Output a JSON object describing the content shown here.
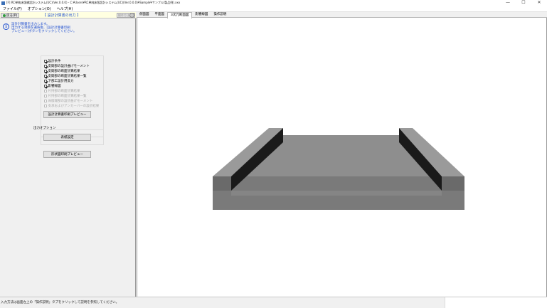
{
  "window": {
    "title": "[F] RC単純床版橋設計システム(UC)(Ver.0.0.0) - C:¥Users¥RC単純床版設計システム(UC)(Ver.0.0.0)¥Sample¥サンプル(製品例).xxx",
    "minimize": "—",
    "maximize": "☐",
    "close": "✕"
  },
  "menu": [
    "ファイル(F)",
    "オプション(O)",
    "ヘルプ(H)"
  ],
  "left": {
    "back_label": "戻る(P)",
    "section_title": "【 設計計算書の出力 】",
    "help_label": "操作方法(H)",
    "info_lines": [
      "設計計算書を出力します。",
      "出力する項目を選択後、[設計計算書印刷",
      "プレビュー]ボタンをクリックしてください。"
    ],
    "checkboxes": [
      {
        "label": "設計条件",
        "checked": true,
        "enabled": true
      },
      {
        "label": "支間部の設計曲げモーメント",
        "checked": true,
        "enabled": true
      },
      {
        "label": "支間部の断面計算結果",
        "checked": true,
        "enabled": true
      },
      {
        "label": "支間部の断面計算結果一覧",
        "checked": true,
        "enabled": true
      },
      {
        "label": "下部工設計用反力",
        "checked": true,
        "enabled": true
      },
      {
        "label": "影響線図",
        "checked": true,
        "enabled": true
      },
      {
        "label": "片持部の断面計算結果",
        "checked": false,
        "enabled": false
      },
      {
        "label": "片持部の断面計算結果一覧",
        "checked": false,
        "enabled": false
      },
      {
        "label": "床版端部の設計曲げモーメント",
        "checked": false,
        "enabled": false
      },
      {
        "label": "支承およびアンカーバーの設計結果",
        "checked": false,
        "enabled": false
      }
    ],
    "preview_button": "設計計算書印刷プレビュー",
    "output_options_label": "出力オプション",
    "print_settings_button": "表紙設定",
    "drawing_preview_button": "形状図印刷プレビュー"
  },
  "tabs": [
    {
      "label": "側面図",
      "active": false
    },
    {
      "label": "平面図",
      "active": false
    },
    {
      "label": "3次元断面図",
      "active": true
    },
    {
      "label": "影響線図",
      "active": false
    },
    {
      "label": "操作説明",
      "active": false
    }
  ],
  "statusbar": {
    "text": "入力方法は画面左上の「操作説明」タブをクリックして説明を参照してください。"
  },
  "colors": {
    "info_blue": "#1f4fcf",
    "model_top": "#8e8e8e",
    "model_front": "#7a7a7a",
    "model_side": "#6a6a6a",
    "model_dark": "#1a1a1a"
  }
}
